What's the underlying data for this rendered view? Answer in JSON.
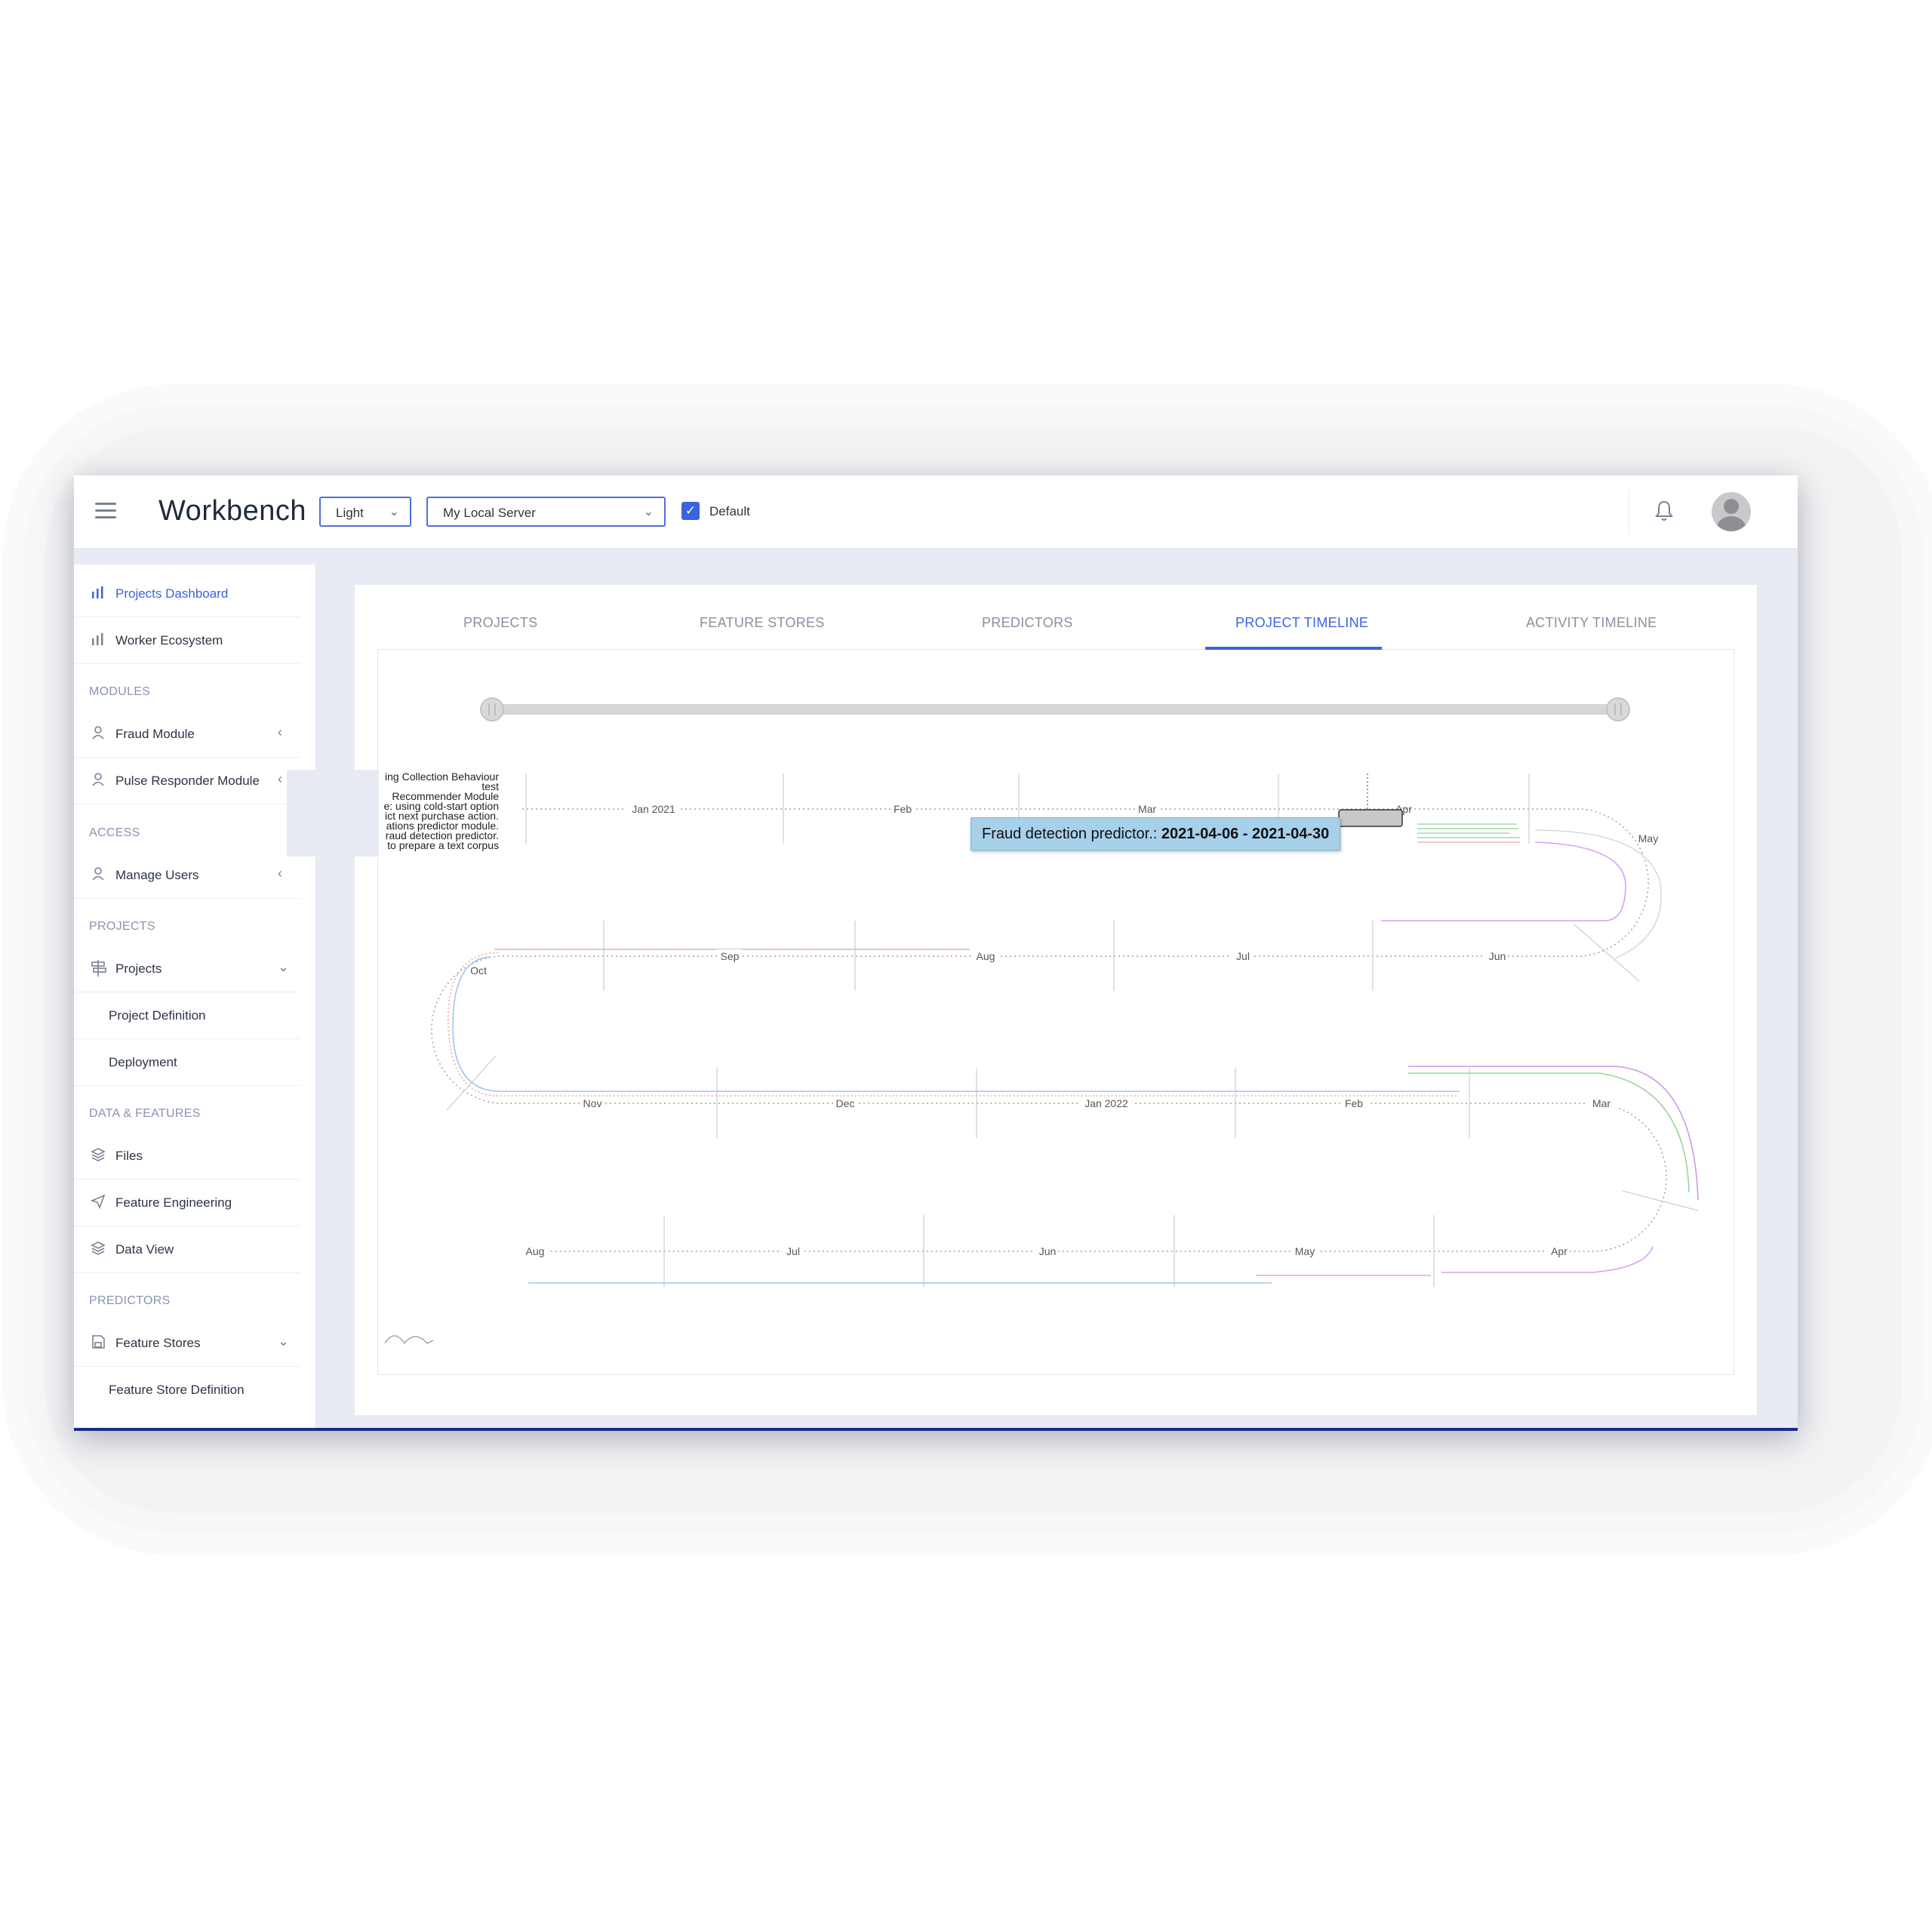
{
  "app": {
    "title": "Workbench",
    "theme_select": "Light",
    "server_select": "My Local Server",
    "default_checkbox_label": "Default",
    "default_checked": true
  },
  "sidebar": {
    "items": [
      {
        "label": "Projects Dashboard",
        "icon": "bar-chart-icon"
      },
      {
        "label": "Worker Ecosystem",
        "icon": "bar-chart-icon"
      },
      {
        "label": "Fraud Module",
        "icon": "user-icon"
      },
      {
        "label": "Pulse Responder Module",
        "icon": "user-icon"
      },
      {
        "label": "Manage Users",
        "icon": "user-icon"
      },
      {
        "label": "Projects",
        "icon": "signpost-icon"
      },
      {
        "label": "Project Definition"
      },
      {
        "label": "Deployment"
      },
      {
        "label": "Files",
        "icon": "layers-icon"
      },
      {
        "label": "Feature Engineering",
        "icon": "send-icon"
      },
      {
        "label": "Data View",
        "icon": "layers-icon"
      },
      {
        "label": "Feature Stores",
        "icon": "save-icon"
      },
      {
        "label": "Feature Store Definition"
      }
    ],
    "headings": [
      "MODULES",
      "ACCESS",
      "PROJECTS",
      "DATA & FEATURES",
      "PREDICTORS"
    ]
  },
  "tabs": [
    "PROJECTS",
    "FEATURE STORES",
    "PREDICTORS",
    "PROJECT TIMELINE",
    "ACTIVITY TIMELINE"
  ],
  "active_tab": "PROJECT TIMELINE",
  "timeline": {
    "project_labels": [
      "ing Collection Behaviour",
      "test",
      "Recommender Module",
      "e: using cold-start option",
      "ict next purchase action.",
      "ations predictor module.",
      "raud detection predictor.",
      "to prepare a text corpus"
    ],
    "row1_months": [
      "Jan 2021",
      "Feb",
      "Mar",
      "Apr",
      "May"
    ],
    "row2_months": [
      "Sep",
      "Aug",
      "Jul",
      "Jun",
      "Oct"
    ],
    "row3_months": [
      "Nov",
      "Dec",
      "Jan 2022",
      "Feb",
      "Mar"
    ],
    "row4_months": [
      "Aug",
      "Jul",
      "Jun",
      "May",
      "Apr"
    ],
    "tooltip_label": "Fraud detection predictor.:",
    "tooltip_range": "2021-04-06 - 2021-04-30"
  }
}
